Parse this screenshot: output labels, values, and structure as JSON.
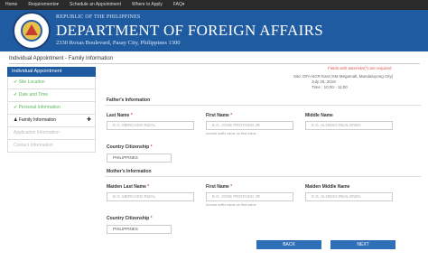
{
  "nav": [
    "Home",
    "Requirements▾",
    "Schedule an Appointment",
    "Where to Apply",
    "FAQ▾"
  ],
  "banner": {
    "republic": "REPUBLIC OF THE PHILIPPINES",
    "department": "DEPARTMENT OF FOREIGN AFFAIRS",
    "address": "2330 Roxas Boulevard, Pasay City, Philippines 1300"
  },
  "page_title": "Individual Appointment - Family Information",
  "sidebar": {
    "header": "Individual Appointment",
    "items": [
      {
        "label": "Site Location",
        "status": "done"
      },
      {
        "label": "Date and Time",
        "status": "done"
      },
      {
        "label": "Personal Information",
        "status": "done"
      },
      {
        "label": "Family Information",
        "status": "current"
      },
      {
        "label": "Application Information",
        "status": "disabled"
      },
      {
        "label": "Contact Information",
        "status": "disabled"
      }
    ]
  },
  "required_note": "Fields with asterisks(*) are required",
  "appointment": {
    "site": "Site: DFA NCR East (SM Megamall, Mandaluyong City)",
    "date": "July 25, 2019",
    "time": "Time : 10:00 - 11:00"
  },
  "father": {
    "title": "Father's Information",
    "last_name_label": "Last Name",
    "last_name_placeholder": "E.G. MERCADO RIZAL",
    "first_name_label": "First Name",
    "first_name_placeholder": "E.G. JOSE PROTASIO JR",
    "first_name_hint": "Include suffix name on first name",
    "middle_name_label": "Middle Name",
    "middle_name_placeholder": "E.G. ALONSO REALONDA",
    "citizenship_label": "Country Citizenship",
    "citizenship_value": "PHILIPPINES"
  },
  "mother": {
    "title": "Mother's Information",
    "last_name_label": "Maiden Last Name",
    "last_name_placeholder": "E.G. MERCADO RIZAL",
    "first_name_label": "First Name",
    "first_name_placeholder": "E.G. JOSE PROTASIO JR",
    "first_name_hint": "Include suffix name on first name",
    "middle_name_label": "Maiden Middle Name",
    "middle_name_placeholder": "E.G. ALONSO REALONDA",
    "citizenship_label": "Country Citizenship",
    "citizenship_value": "PHILIPPINES"
  },
  "buttons": {
    "back": "BACK",
    "next": "NEXT"
  },
  "star": "*",
  "check_icon": "✔",
  "family_icon": "♟",
  "arrow_icon": "✚"
}
